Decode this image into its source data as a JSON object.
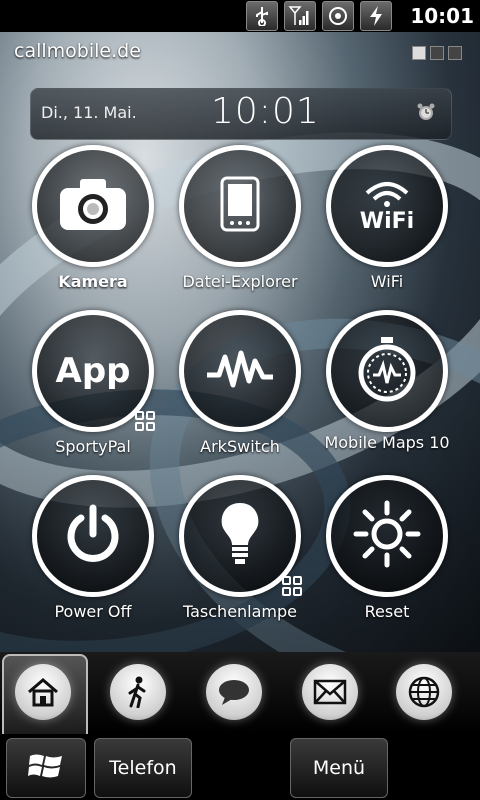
{
  "statusbar": {
    "icons": [
      "usb-icon",
      "signal-icon",
      "sync-icon",
      "charging-icon"
    ],
    "time": "10:01"
  },
  "operator": "callmobile.de",
  "clock": {
    "date": "Di., 11. Mai.",
    "time": "10:01"
  },
  "tiles": [
    {
      "label": "Kamera",
      "icon": "camera-icon",
      "bold": true
    },
    {
      "label": "Datei-Explorer",
      "icon": "file-explorer-icon"
    },
    {
      "label": "WiFi",
      "icon": "wifi-icon",
      "icon_text": "WiFi"
    },
    {
      "label": "SportyPal",
      "icon": "app-icon",
      "icon_text": "App"
    },
    {
      "label": "ArkSwitch",
      "icon": "pulse-icon"
    },
    {
      "label": "Mobile Maps 10",
      "icon": "stopwatch-icon"
    },
    {
      "label": "Power Off",
      "icon": "power-icon"
    },
    {
      "label": "Taschenlampe",
      "icon": "lightbulb-icon"
    },
    {
      "label": "Reset",
      "icon": "sun-icon"
    }
  ],
  "dock": {
    "items": [
      "home-icon",
      "walking-person-icon",
      "speech-bubble-icon",
      "mail-icon",
      "globe-icon"
    ]
  },
  "softkeys": {
    "left": "Telefon",
    "right": "Menü"
  }
}
